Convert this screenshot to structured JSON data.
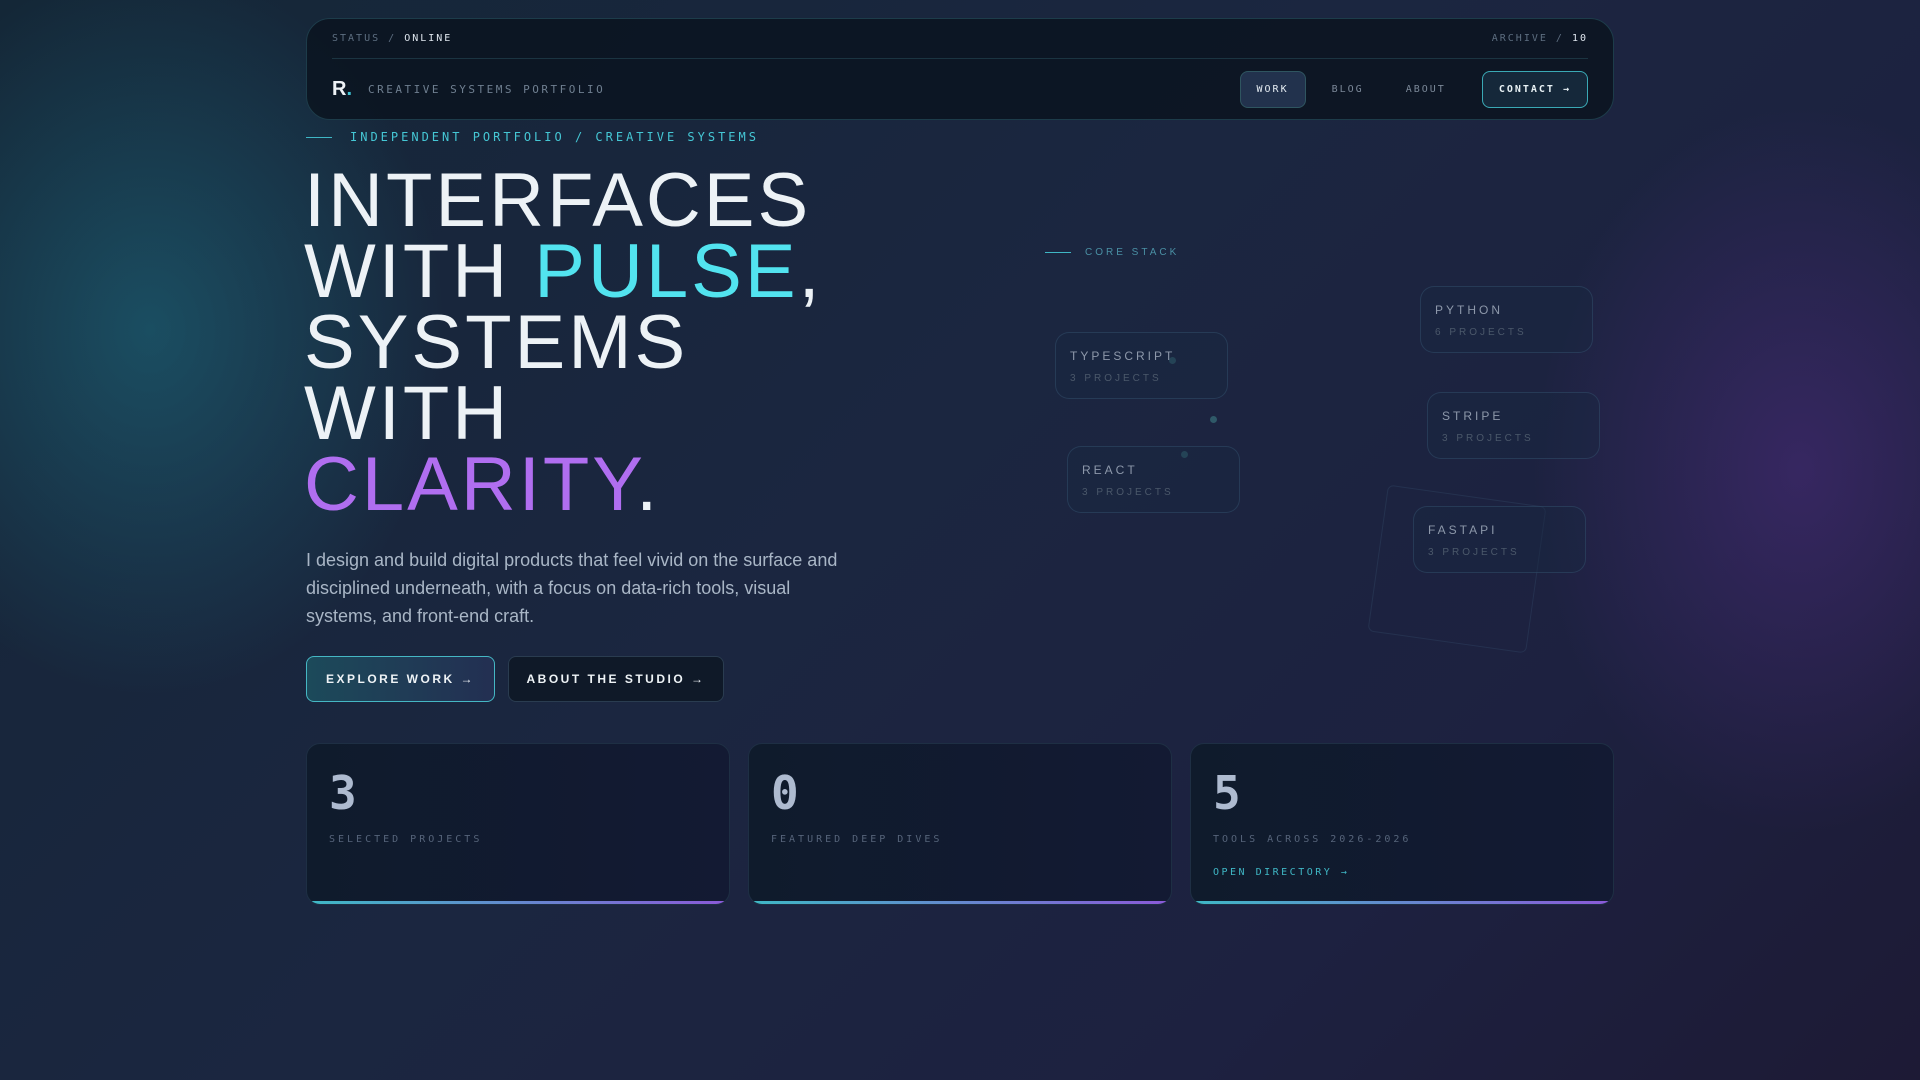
{
  "nav": {
    "status_label": "STATUS",
    "status_value": "ONLINE",
    "archive_label": "ARCHIVE",
    "archive_value": "10",
    "logo": "R",
    "logo_dot": ".",
    "tagline": "CREATIVE SYSTEMS PORTFOLIO",
    "links": [
      "WORK",
      "BLOG",
      "ABOUT"
    ],
    "contact": "CONTACT →"
  },
  "hero": {
    "eyebrow": "INDEPENDENT PORTFOLIO / CREATIVE SYSTEMS",
    "line1": "INTERFACES",
    "line2a": "WITH ",
    "line2b": "PULSE",
    "line2c": ",",
    "line3": "SYSTEMS",
    "line4": "WITH",
    "line5a": "CLARITY",
    "line5b": ".",
    "paragraph": "I design and build digital products that feel vivid on the surface and disciplined underneath, with a focus on data-rich tools, visual systems, and front-end craft.",
    "btn_primary": "EXPLORE WORK →",
    "btn_secondary": "ABOUT THE STUDIO →"
  },
  "stack": {
    "label": "CORE STACK",
    "items": [
      {
        "name": "TYPESCRIPT",
        "count": "3 PROJECTS"
      },
      {
        "name": "PYTHON",
        "count": "6 PROJECTS"
      },
      {
        "name": "STRIPE",
        "count": "3 PROJECTS"
      },
      {
        "name": "REACT",
        "count": "3 PROJECTS"
      },
      {
        "name": "FASTAPI",
        "count": "3 PROJECTS"
      }
    ]
  },
  "stats": [
    {
      "value": "3",
      "label": "SELECTED PROJECTS"
    },
    {
      "value": "0",
      "label": "FEATURED DEEP DIVES"
    },
    {
      "value": "5",
      "label": "TOOLS ACROSS 2026-2026",
      "link": "OPEN DIRECTORY →"
    }
  ],
  "colors": {
    "accent_cyan": "#52e3ef",
    "accent_purple": "#b06ef0"
  }
}
